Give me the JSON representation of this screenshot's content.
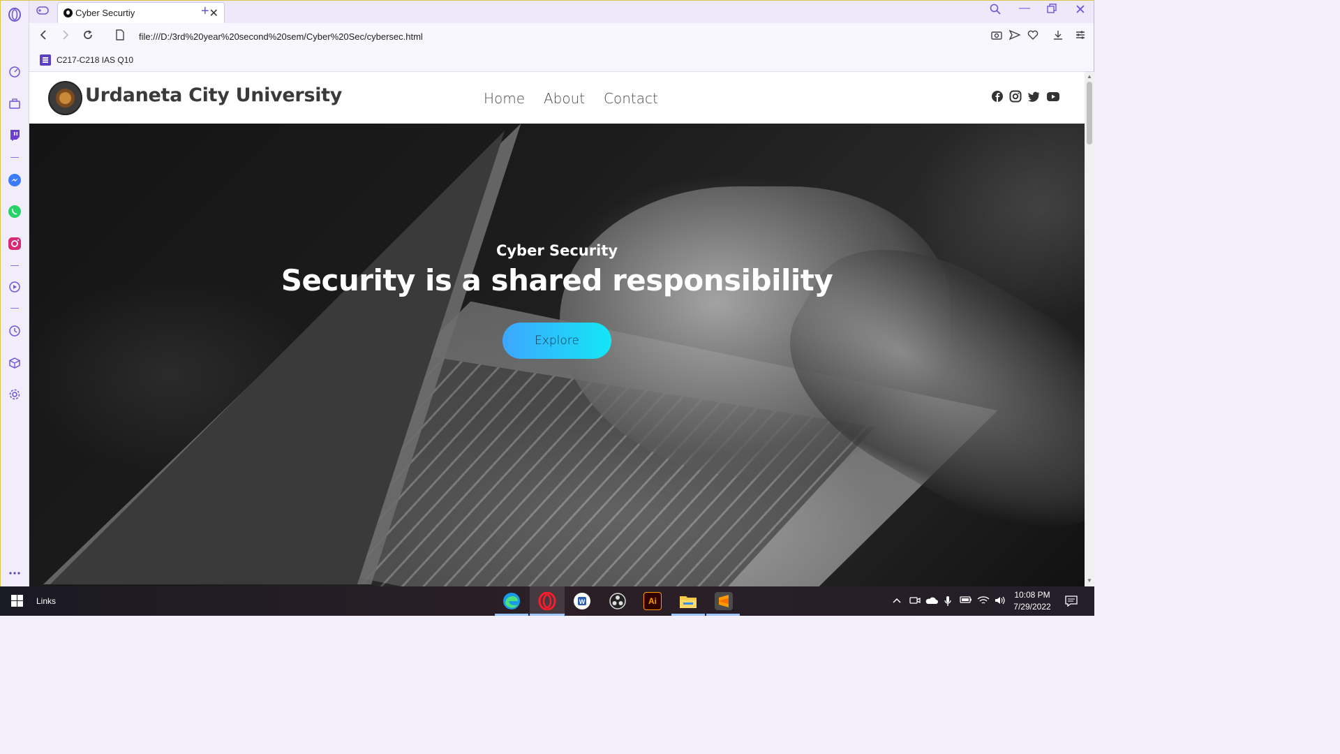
{
  "browser": {
    "tab_title": "Cyber Securtiy",
    "url": "file:///D:/3rd%20year%20second%20sem/Cyber%20Sec/cybersec.html",
    "bookmark_label": "C217-C218 IAS Q10"
  },
  "site": {
    "university_name": "Urdaneta City University",
    "nav": {
      "home": "Home",
      "about": "About",
      "contact": "Contact"
    },
    "social_icons": [
      "facebook-icon",
      "instagram-icon",
      "twitter-icon",
      "youtube-icon"
    ],
    "hero": {
      "subtitle": "Cyber Security",
      "title": "Security is a shared responsibility",
      "cta": "Explore"
    }
  },
  "taskbar": {
    "links_label": "Links",
    "time": "10:08 PM",
    "date": "7/29/2022",
    "apps": [
      "edge-icon",
      "opera-icon",
      "word-icon",
      "obs-icon",
      "illustrator-icon",
      "file-explorer-icon",
      "sublime-text-icon"
    ]
  },
  "colors": {
    "accent_purple": "#7156d4",
    "explore_start": "#3ea6ff",
    "explore_end": "#14e6f5"
  }
}
